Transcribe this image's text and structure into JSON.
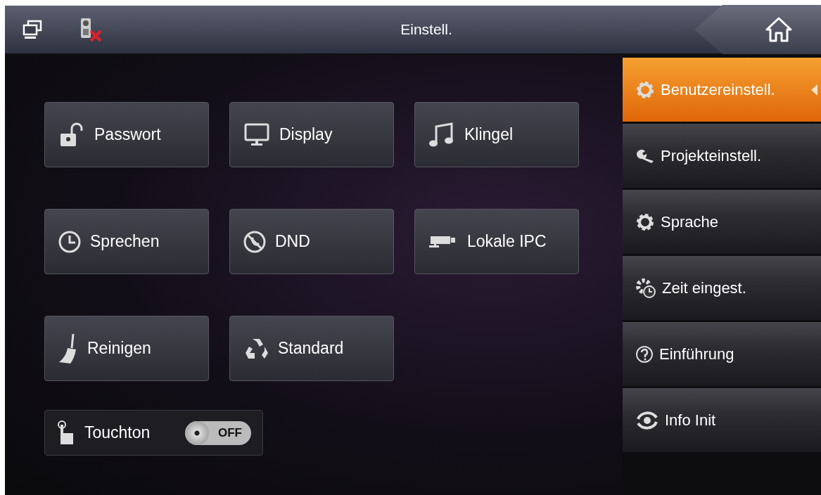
{
  "header": {
    "title": "Einstell."
  },
  "tiles": [
    {
      "label": "Passwort"
    },
    {
      "label": "Display"
    },
    {
      "label": "Klingel"
    },
    {
      "label": "Sprechen"
    },
    {
      "label": "DND"
    },
    {
      "label": "Lokale IPC"
    },
    {
      "label": "Reinigen"
    },
    {
      "label": "Standard"
    }
  ],
  "touch_tone": {
    "label": "Touchton",
    "toggle": {
      "on": false,
      "text": "OFF"
    }
  },
  "sidebar": {
    "items": [
      {
        "label": "Benutzereinstell.",
        "selected": true
      },
      {
        "label": "Projekteinstell.",
        "selected": false
      },
      {
        "label": "Sprache",
        "selected": false
      },
      {
        "label": "Zeit eingest.",
        "selected": false
      },
      {
        "label": "Einführung",
        "selected": false
      },
      {
        "label": "Info Init",
        "selected": false
      }
    ]
  }
}
